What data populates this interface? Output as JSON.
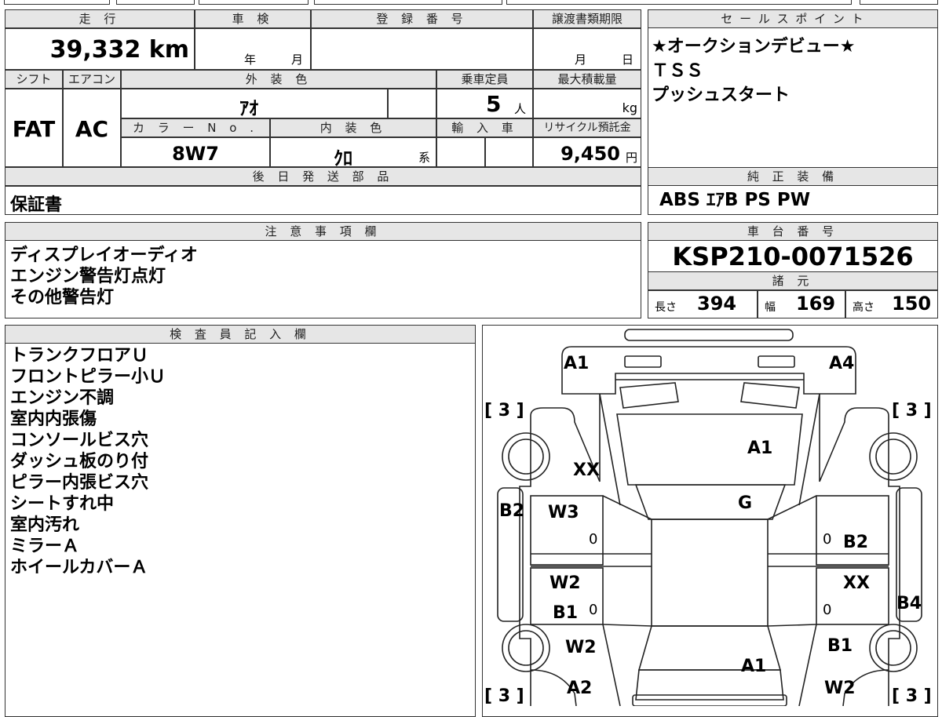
{
  "headers": {
    "mileage": "走 行",
    "inspection": "車 検",
    "registration": "登 録 番 号",
    "transfer_deadline": "譲渡書類期限",
    "sales_points": "セ ー ル ス ポ イ ン ト",
    "shift": "シフト",
    "aircon": "エアコン",
    "exterior_color": "外 装 色",
    "capacity": "乗車定員",
    "max_load": "最大積載量",
    "color_no": "カ ラ ー N o .",
    "interior_color": "内 装 色",
    "imported": "輸 入 車",
    "recycle_fee": "リサイクル預託金",
    "later_parts": "後 日 発 送 部 品",
    "options": "純 正 装 備",
    "notes": "注 意 事 項 欄",
    "chassis": "車 台 番 号",
    "specs": "諸 元",
    "inspector": "検 査 員 記 入 欄"
  },
  "values": {
    "mileage": "39,332 km",
    "inspection_year": "年",
    "inspection_month": "月",
    "transfer_month": "月",
    "transfer_day": "日",
    "shift": "FAT",
    "aircon": "AC",
    "exterior_color": "ｱｵ",
    "capacity": "5",
    "capacity_unit": "人",
    "max_load_unit": "kg",
    "color_no": "8W7",
    "interior_color": "ｸﾛ",
    "interior_suffix": "系",
    "recycle_fee": "9,450",
    "recycle_unit": "円",
    "later_parts": "保証書",
    "options": "ABS ｴｱB PS PW",
    "chassis": "KSP210-0071526",
    "length_label": "長さ",
    "length": "394",
    "width_label": "幅",
    "width": "169",
    "height_label": "高さ",
    "height": "150"
  },
  "sales_points": [
    "★オークションデビュー★",
    "ＴＳＳ",
    "プッシュスタート"
  ],
  "notes": [
    "ディスプレイオーディオ",
    "エンジン警告灯点灯",
    "その他警告灯"
  ],
  "inspector_notes": [
    "トランクフロアＵ",
    "フロントピラー小Ｕ",
    "エンジン不調",
    "室内内張傷",
    "コンソールビス穴",
    "ダッシュ板のり付",
    "ピラー内張ビス穴",
    "シートすれ中",
    "室内汚れ",
    "ミラーＡ",
    "ホイールカバーＡ"
  ],
  "diagram": {
    "labels": {
      "a1_top_left": "A1",
      "a4_top_right": "A4",
      "bracket_tl": "[ 3 ]",
      "bracket_tr": "[ 3 ]",
      "bracket_bl": "[ 3 ]",
      "bracket_br": "[ 3 ]",
      "xx_left": "XX",
      "a1_hood": "A1",
      "g_windshield": "G",
      "b2_left": "B2",
      "w3_left": "W3",
      "zero_1": "0",
      "zero_2": "0",
      "b2_right": "B2",
      "w2_left_door": "W2",
      "xx_right": "XX",
      "b1_left": "B1",
      "zero_3": "0",
      "zero_4": "0",
      "b4_right": "B4",
      "w2_left_rear": "W2",
      "b1_right": "B1",
      "a1_roof": "A1",
      "a2_left": "A2",
      "w2_right_rear": "W2"
    }
  }
}
